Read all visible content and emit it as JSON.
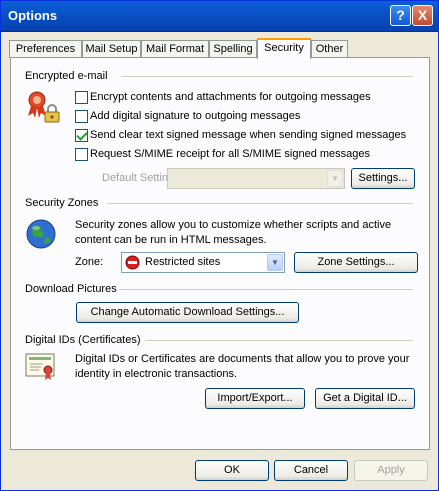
{
  "window": {
    "title": "Options",
    "help_label": "?",
    "close_label": "X"
  },
  "tabs": [
    {
      "label": "Preferences",
      "active": false
    },
    {
      "label": "Mail Setup",
      "active": false
    },
    {
      "label": "Mail Format",
      "active": false
    },
    {
      "label": "Spelling",
      "active": false
    },
    {
      "label": "Security",
      "active": true
    },
    {
      "label": "Other",
      "active": false
    }
  ],
  "encrypted_email": {
    "title": "Encrypted e-mail",
    "options": [
      {
        "label": "Encrypt contents and attachments for outgoing messages",
        "checked": false
      },
      {
        "label": "Add digital signature to outgoing messages",
        "checked": false
      },
      {
        "label": "Send clear text signed message when sending signed messages",
        "checked": true
      },
      {
        "label": "Request S/MIME receipt for all S/MIME signed messages",
        "checked": false
      }
    ],
    "default_setting_label": "Default Setting:",
    "default_setting_value": "",
    "settings_button": "Settings..."
  },
  "security_zones": {
    "title": "Security Zones",
    "description": "Security zones allow you to customize whether scripts and active content can be run in HTML messages.",
    "zone_label": "Zone:",
    "zone_value": "Restricted sites",
    "zone_settings_button": "Zone Settings..."
  },
  "download_pictures": {
    "title": "Download Pictures",
    "button": "Change Automatic Download Settings..."
  },
  "digital_ids": {
    "title": "Digital IDs (Certificates)",
    "description": "Digital IDs or Certificates are documents that allow you to prove your identity in electronic transactions.",
    "import_export_button": "Import/Export...",
    "get_id_button": "Get a Digital ID..."
  },
  "footer": {
    "ok": "OK",
    "cancel": "Cancel",
    "apply": "Apply"
  }
}
